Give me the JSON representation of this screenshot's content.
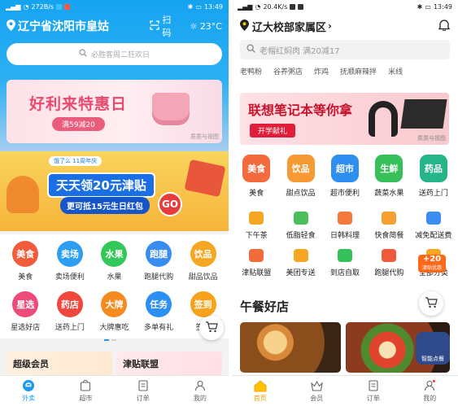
{
  "left": {
    "status": {
      "speed": "272B/s",
      "time": "13:49"
    },
    "location": "辽宁省沈阳市皇姑",
    "scan_label": "扫码",
    "weather_label": "23°C",
    "search_placeholder": "必胜客周二狂欢日",
    "banner": {
      "title": "好利来特惠日",
      "subtitle": "满59减20",
      "tag": "质质与视图"
    },
    "promo": {
      "ribbon": "饿了么 11周年庆",
      "main": "天天领20元津贴",
      "sub": "更可抵15元生日红包",
      "go": "GO"
    },
    "categories": [
      [
        {
          "label": "美食",
          "icon": "美食",
          "color": "#f25b3b"
        },
        {
          "label": "卖场便利",
          "icon": "卖场",
          "color": "#2d9ff2"
        },
        {
          "label": "水果",
          "icon": "水果",
          "color": "#34c759"
        },
        {
          "label": "跑腿代购",
          "icon": "跑腿",
          "color": "#3a8df0"
        },
        {
          "label": "甜品饮品",
          "icon": "饮品",
          "color": "#f5a623"
        }
      ],
      [
        {
          "label": "星选好店",
          "icon": "星选",
          "color": "#ee4a7a"
        },
        {
          "label": "送药上门",
          "icon": "药店",
          "color": "#f0463c"
        },
        {
          "label": "大牌惠吃",
          "icon": "大牌",
          "color": "#f58a1f"
        },
        {
          "label": "多单有礼",
          "icon": "任务",
          "color": "#2b8ff3"
        },
        {
          "label": "签到",
          "icon": "签到",
          "color": "#f6a31b"
        }
      ]
    ],
    "cards": [
      "超级会员",
      "津贴联盟"
    ],
    "tabs": [
      {
        "label": "外卖",
        "icon": "takeout-icon"
      },
      {
        "label": "超市",
        "icon": "supermarket-icon"
      },
      {
        "label": "订单",
        "icon": "order-icon"
      },
      {
        "label": "我的",
        "icon": "profile-icon"
      }
    ]
  },
  "right": {
    "status": {
      "speed": "20.4K/s",
      "time": "13:49"
    },
    "address": "辽大校部家属区",
    "search_placeholder": "老帽红焖肉 满20减17",
    "hot_words": [
      "老鸭粉",
      "谷养粥店",
      "炸鸡",
      "抚顺麻辣拌",
      "米线"
    ],
    "banner": {
      "title": "联想笔记本等你拿",
      "button": "开学献礼",
      "tag": "质质与视图"
    },
    "primary": [
      {
        "label": "美食",
        "icon": "美食",
        "color": "#f36a3c"
      },
      {
        "label": "甜点饮品",
        "icon": "饮品",
        "color": "#f79a34"
      },
      {
        "label": "超市便利",
        "icon": "超市",
        "color": "#2f8ff0"
      },
      {
        "label": "蔬菜水果",
        "icon": "生鲜",
        "color": "#36c05a"
      },
      {
        "label": "送药上门",
        "icon": "药品",
        "color": "#26b489"
      }
    ],
    "secondary": [
      [
        {
          "label": "下午茶",
          "color": "#f5a623"
        },
        {
          "label": "低脂轻食",
          "color": "#4cbf5a"
        },
        {
          "label": "日韩料理",
          "color": "#f27a3a"
        },
        {
          "label": "快食简餐",
          "color": "#f6a031"
        },
        {
          "label": "减免配送费",
          "color": "#3b8ef0"
        }
      ],
      [
        {
          "label": "津贴联盟",
          "color": "#f26b3a"
        },
        {
          "label": "美团专送",
          "color": "#f5a623"
        },
        {
          "label": "到店自取",
          "color": "#36c05a"
        },
        {
          "label": "跑腿代购",
          "color": "#ef5a3a"
        },
        {
          "label": "全部分类",
          "color": "#f5a623"
        }
      ]
    ],
    "badge": {
      "value": "+20",
      "label": "津贴优惠"
    },
    "section_title": "午餐好店",
    "robot_label": "智能点餐",
    "tabs": [
      {
        "label": "首页",
        "icon": "home-icon"
      },
      {
        "label": "会员",
        "icon": "crown-icon"
      },
      {
        "label": "订单",
        "icon": "order-icon"
      },
      {
        "label": "我的",
        "icon": "profile-icon"
      }
    ]
  },
  "colors": {
    "eleme_blue": "#1a9bf0",
    "meituan_yellow": "#ffc300"
  }
}
